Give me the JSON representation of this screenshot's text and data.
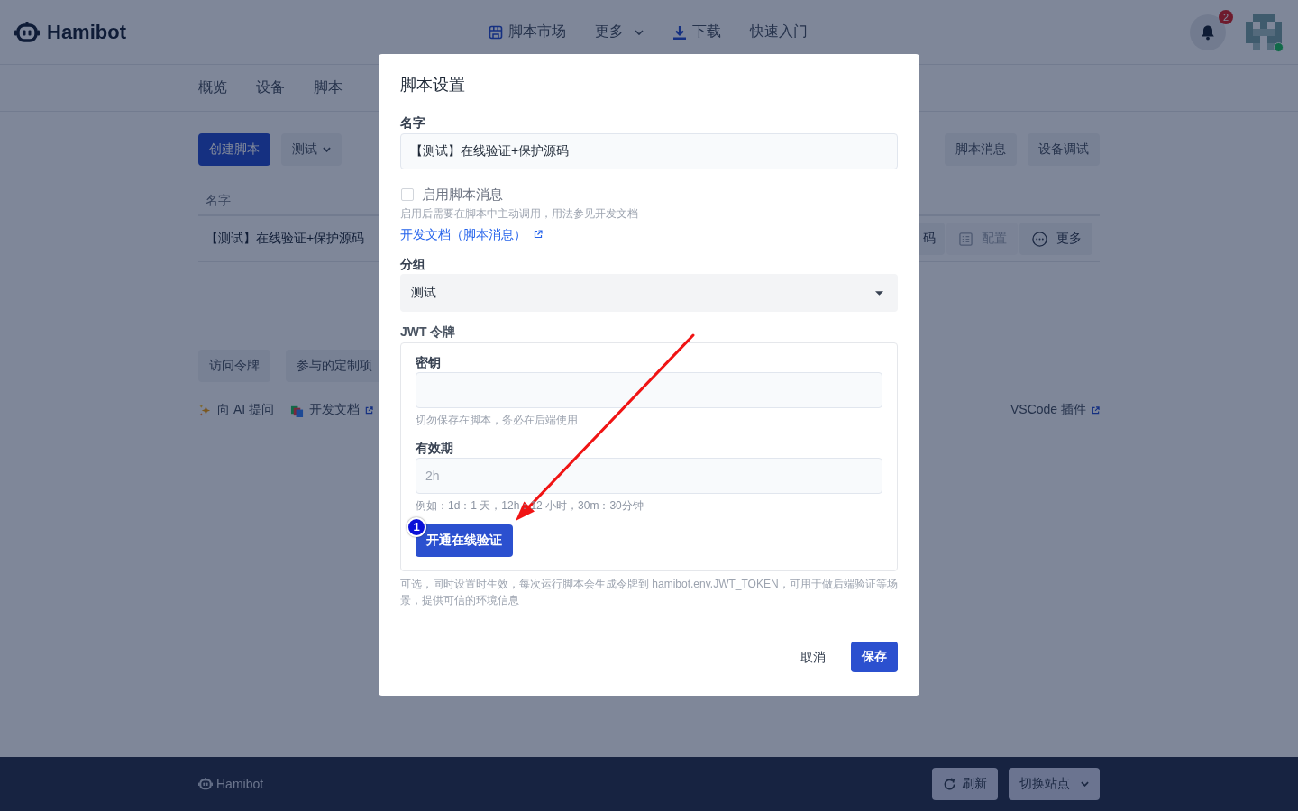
{
  "header": {
    "logo": "Hamibot",
    "nav": [
      {
        "kind": "store",
        "label": "脚本市场"
      },
      {
        "kind": "menu",
        "label": "更多"
      },
      {
        "kind": "download",
        "label": "下载"
      },
      {
        "kind": "plain",
        "label": "快速入门"
      }
    ],
    "notification_count": "2",
    "avatar": {
      "online": true
    }
  },
  "tabs": [
    {
      "label": "概览",
      "selected": false
    },
    {
      "label": "设备",
      "selected": false
    },
    {
      "label": "脚本",
      "selected": false
    }
  ],
  "toolbar": {
    "create_button": "创建脚本",
    "group_filter": "测试",
    "right_buttons": [
      "脚本消息",
      "设备调试"
    ]
  },
  "table": {
    "columns": [
      "名字"
    ],
    "rows": [
      {
        "name": "【测试】在线验证+保护源码",
        "actions": [
          {
            "kind": "text",
            "label": "码",
            "disabled": false
          },
          {
            "kind": "config",
            "label": "配置",
            "disabled": true
          },
          {
            "kind": "more",
            "label": "更多",
            "disabled": false
          }
        ]
      }
    ]
  },
  "extra_buttons": [
    "访问令牌",
    "参与的定制项"
  ],
  "links": [
    {
      "kind": "ai",
      "label": "向 AI 提问",
      "external": false
    },
    {
      "kind": "docs",
      "label": "开发文档",
      "external": true
    }
  ],
  "right_links": [
    {
      "label": "VSCode 插件",
      "external": true
    }
  ],
  "footer": {
    "logo": "Hamibot",
    "buttons": [
      {
        "kind": "refresh",
        "label": "刷新"
      },
      {
        "kind": "dropdown",
        "label": "切换站点"
      }
    ]
  },
  "dialog": {
    "title": "脚本设置",
    "name_field": {
      "label": "名字",
      "value": "【测试】在线验证+保护源码"
    },
    "message_option": {
      "label": "启用脚本消息",
      "checked": false,
      "hint": "启用后需要在脚本中主动调用，用法参见开发文档",
      "link": "开发文档（脚本消息）"
    },
    "group_field": {
      "label": "分组",
      "value": "测试"
    },
    "jwt": {
      "label": "JWT 令牌",
      "secret": {
        "label": "密钥",
        "hint": "切勿保存在脚本，务必在后端使用"
      },
      "expiry": {
        "label": "有效期",
        "placeholder": "2h",
        "hint": "例如：1d：1 天，12h：12 小时，30m：30分钟"
      },
      "enable_button": "开通在线验证",
      "hint": "可选，同时设置时生效，每次运行脚本会生成令牌到 hamibot.env.JWT_TOKEN，可用于做后端验证等场景，提供可信的环境信息"
    },
    "buttons": [
      {
        "kind": "text",
        "label": "取消"
      },
      {
        "kind": "primary",
        "label": "保存"
      }
    ]
  },
  "annotation": {
    "step": "1"
  }
}
